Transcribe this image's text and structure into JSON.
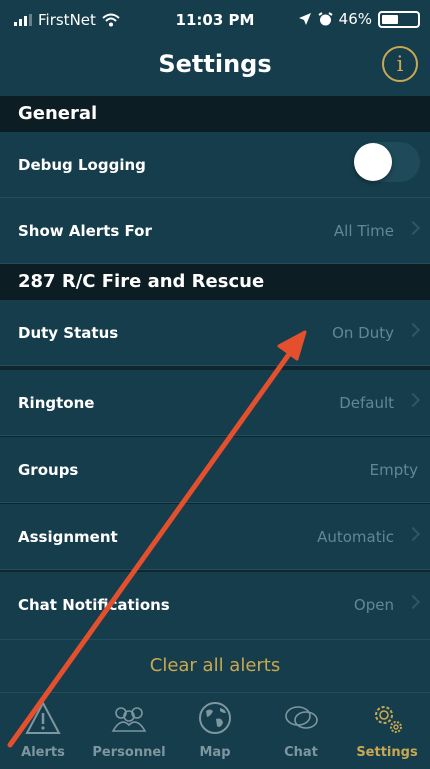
{
  "status_bar": {
    "carrier": "FirstNet",
    "time": "11:03 PM",
    "battery": "46%",
    "battery_level": 0.46
  },
  "header": {
    "title": "Settings",
    "info_glyph": "i"
  },
  "sections": [
    {
      "title": "General"
    },
    {
      "title": "287 R/C Fire and Rescue"
    }
  ],
  "rows": {
    "debug_logging": {
      "label": "Debug Logging",
      "enabled": false
    },
    "show_alerts_for": {
      "label": "Show Alerts For",
      "value": "All Time"
    },
    "duty_status": {
      "label": "Duty Status",
      "value": "On Duty"
    },
    "ringtone": {
      "label": "Ringtone",
      "value": "Default"
    },
    "groups": {
      "label": "Groups",
      "value": "Empty"
    },
    "assignment": {
      "label": "Assignment",
      "value": "Automatic"
    },
    "chat_notifications": {
      "label": "Chat Notifications",
      "value": "Open"
    }
  },
  "clear_all": "Clear all alerts",
  "tabs": [
    {
      "label": "Alerts",
      "icon": "alert-triangle-icon"
    },
    {
      "label": "Personnel",
      "icon": "people-icon"
    },
    {
      "label": "Map",
      "icon": "globe-icon"
    },
    {
      "label": "Chat",
      "icon": "chat-bubbles-icon"
    },
    {
      "label": "Settings",
      "icon": "gears-icon",
      "active": true
    }
  ],
  "colors": {
    "accent": "#c9a853",
    "row_bg": "#163d4b",
    "section_bg": "#0c1d24",
    "value_text": "#5e8996",
    "annotation_arrow": "#e4502d"
  }
}
